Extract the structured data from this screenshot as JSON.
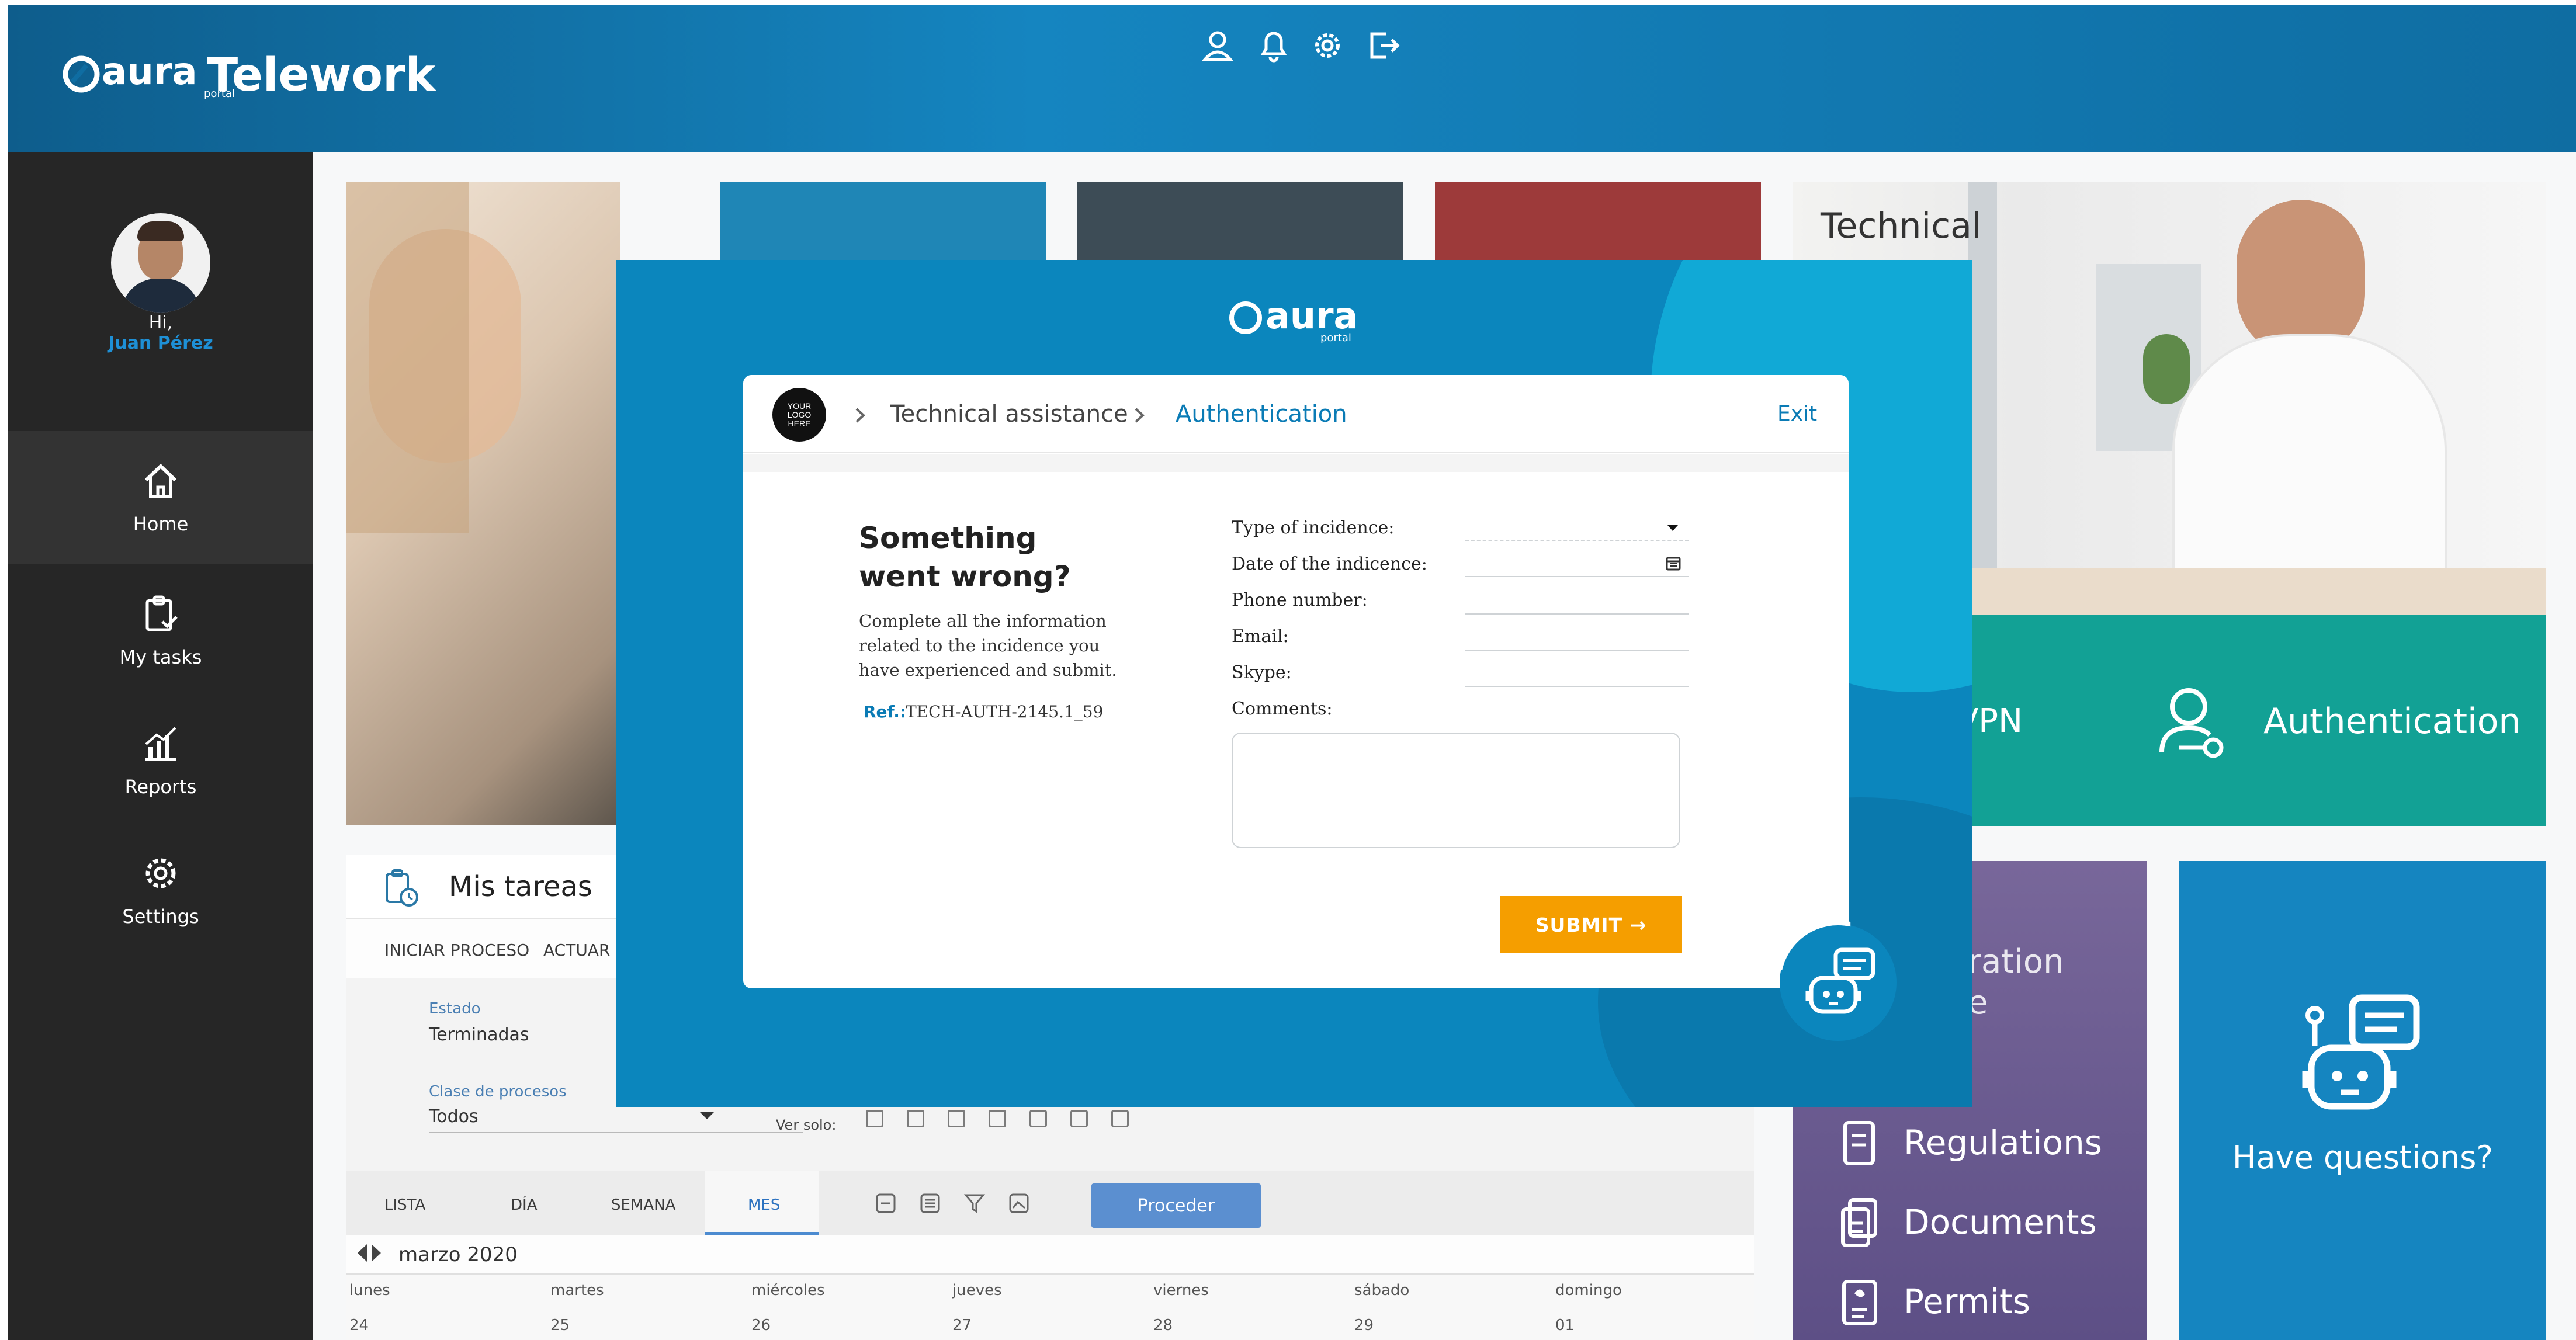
{
  "header": {
    "brand": "aura",
    "brand_sub": "portal",
    "app_title": "Telework",
    "icons": [
      "user-icon",
      "bell-icon",
      "gear-icon",
      "logout-icon"
    ]
  },
  "sidebar": {
    "greeting": "Hi,",
    "user_name": "Juan Pérez",
    "items": [
      {
        "label": "Home",
        "icon": "home-icon"
      },
      {
        "label": "My tasks",
        "icon": "tasks-icon"
      },
      {
        "label": "Reports",
        "icon": "reports-icon"
      },
      {
        "label": "Settings",
        "icon": "gear-icon"
      }
    ]
  },
  "tiles": {
    "technical_title": "Technical",
    "vpn_partial": "VPN",
    "authentication": "Authentication",
    "configuration_partial": "ration",
    "configuration_partial_2": "e",
    "regulations": "Regulations",
    "documents": "Documents",
    "permits": "Permits",
    "have_questions": "Have questions?"
  },
  "tasks_panel": {
    "title": "Mis tareas",
    "actions": [
      "INICIAR PROCESO",
      "ACTUAR E"
    ],
    "estado_label": "Estado",
    "estado_value": "Terminadas",
    "clase_label": "Clase de procesos",
    "clase_value": "Todos",
    "ver_solo": "Ver solo:",
    "views": [
      "LISTA",
      "DÍA",
      "SEMANA",
      "MES"
    ],
    "active_view": "MES",
    "proceder": "Proceder",
    "month": "marzo 2020",
    "weekdays": [
      "lunes",
      "martes",
      "miércoles",
      "jueves",
      "viernes",
      "sábado",
      "domingo"
    ],
    "dates": [
      "24",
      "25",
      "26",
      "27",
      "28",
      "29",
      "01"
    ]
  },
  "modal": {
    "brand": "aura",
    "brand_sub": "portal",
    "logo_placeholder": "YOUR LOGO HERE",
    "breadcrumb": [
      "Technical assistance",
      "Authentication"
    ],
    "exit": "Exit",
    "heading_line1": "Something",
    "heading_line2": "went wrong?",
    "description": "Complete all the information related to the incidence you have experienced and submit.",
    "ref_label": "Ref.:",
    "ref_value": "TECH-AUTH-2145.1_59",
    "fields": {
      "type": "Type of incidence:",
      "date": "Date of the indicence:",
      "phone": "Phone number:",
      "email": "Email:",
      "skype": "Skype:",
      "comments": "Comments:"
    },
    "submit": "SUBMIT →"
  },
  "colors": {
    "header_blue": "#1585c0",
    "modal_blue": "#0b86bd",
    "teal": "#12a195",
    "purple": "#6b5b8e",
    "orange": "#f59e00",
    "link_blue": "#0a7bb5"
  }
}
